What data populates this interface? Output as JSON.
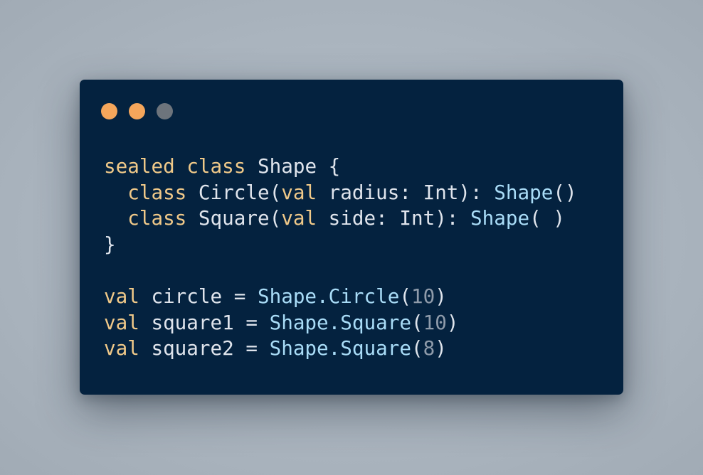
{
  "window": {
    "background": "#04223f",
    "controls": [
      {
        "name": "window-dot-orange-1-icon",
        "color": "#f5a65b"
      },
      {
        "name": "window-dot-orange-2-icon",
        "color": "#f5a65b"
      },
      {
        "name": "window-dot-gray-icon",
        "color": "#6d747c"
      }
    ]
  },
  "code": {
    "language": "kotlin",
    "colors": {
      "keyword": "#f0c989",
      "type": "#a9dcf7",
      "number": "#8f9baa",
      "plain": "#dfe4ec"
    },
    "lines": [
      [
        {
          "t": "sealed",
          "c": "keyword"
        },
        {
          "t": " ",
          "c": "plain"
        },
        {
          "t": "class",
          "c": "keyword"
        },
        {
          "t": " Shape {",
          "c": "plain"
        }
      ],
      [
        {
          "t": "  ",
          "c": "plain"
        },
        {
          "t": "class",
          "c": "keyword"
        },
        {
          "t": " Circle(",
          "c": "plain"
        },
        {
          "t": "val",
          "c": "keyword"
        },
        {
          "t": " radius: Int): ",
          "c": "plain"
        },
        {
          "t": "Shape",
          "c": "type"
        },
        {
          "t": "()",
          "c": "plain"
        }
      ],
      [
        {
          "t": "  ",
          "c": "plain"
        },
        {
          "t": "class",
          "c": "keyword"
        },
        {
          "t": " Square(",
          "c": "plain"
        },
        {
          "t": "val",
          "c": "keyword"
        },
        {
          "t": " side: Int): ",
          "c": "plain"
        },
        {
          "t": "Shape",
          "c": "type"
        },
        {
          "t": "( )",
          "c": "plain"
        }
      ],
      [
        {
          "t": "}",
          "c": "plain"
        }
      ],
      [],
      [
        {
          "t": "val",
          "c": "keyword"
        },
        {
          "t": " circle = ",
          "c": "plain"
        },
        {
          "t": "Shape.Circle",
          "c": "type"
        },
        {
          "t": "(",
          "c": "plain"
        },
        {
          "t": "10",
          "c": "number"
        },
        {
          "t": ")",
          "c": "plain"
        }
      ],
      [
        {
          "t": "val",
          "c": "keyword"
        },
        {
          "t": " square1 = ",
          "c": "plain"
        },
        {
          "t": "Shape.Square",
          "c": "type"
        },
        {
          "t": "(",
          "c": "plain"
        },
        {
          "t": "10",
          "c": "number"
        },
        {
          "t": ")",
          "c": "plain"
        }
      ],
      [
        {
          "t": "val",
          "c": "keyword"
        },
        {
          "t": " square2 = ",
          "c": "plain"
        },
        {
          "t": "Shape.Square",
          "c": "type"
        },
        {
          "t": "(",
          "c": "plain"
        },
        {
          "t": "8",
          "c": "number"
        },
        {
          "t": ")",
          "c": "plain"
        }
      ]
    ]
  }
}
